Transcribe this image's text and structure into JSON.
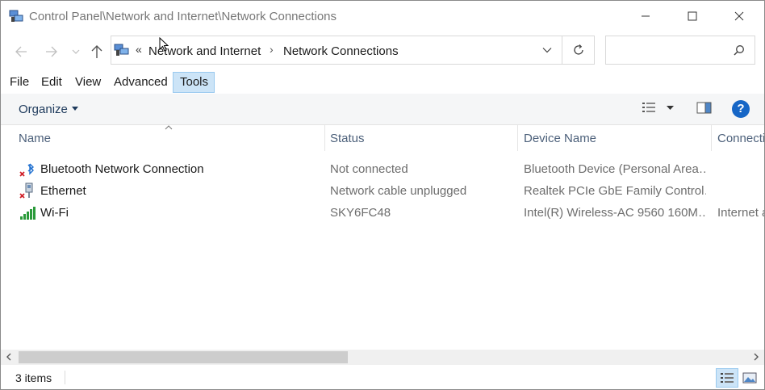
{
  "window": {
    "title": "Control Panel\\Network and Internet\\Network Connections"
  },
  "address": {
    "overflow_chevron": "«",
    "crumbs": [
      "Network and Internet",
      "Network Connections"
    ],
    "separator": "›"
  },
  "search": {
    "placeholder": "",
    "value": ""
  },
  "menu": {
    "items": [
      "File",
      "Edit",
      "View",
      "Advanced",
      "Tools"
    ],
    "active": "Tools"
  },
  "command_bar": {
    "organize_label": "Organize",
    "help_label": "?"
  },
  "columns": [
    "Name",
    "Status",
    "Device Name",
    "Connecti"
  ],
  "rows": [
    {
      "name": "Bluetooth Network Connection",
      "status": "Not connected",
      "device": "Bluetooth Device (Personal Area…",
      "connectivity": "",
      "icon": "bluetooth-network-icon"
    },
    {
      "name": "Ethernet",
      "status": "Network cable unplugged",
      "device": "Realtek PCIe GbE Family Control…",
      "connectivity": "",
      "icon": "ethernet-icon"
    },
    {
      "name": "Wi-Fi",
      "status": "SKY6FC48",
      "device": "Intel(R) Wireless-AC 9560 160M…",
      "connectivity": "Internet a",
      "icon": "wifi-signal-icon"
    }
  ],
  "status_bar": {
    "items_count": "3 items"
  },
  "colors": {
    "accent": "#1666c6",
    "selection": "#cce4f7",
    "selection_border": "#99c9ef",
    "link_text": "#1e3a5c"
  }
}
